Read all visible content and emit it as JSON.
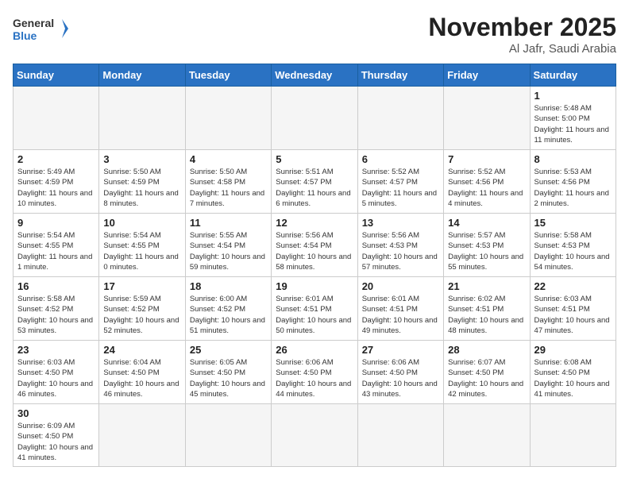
{
  "header": {
    "logo_general": "General",
    "logo_blue": "Blue",
    "title": "November 2025",
    "subtitle": "Al Jafr, Saudi Arabia"
  },
  "weekdays": [
    "Sunday",
    "Monday",
    "Tuesday",
    "Wednesday",
    "Thursday",
    "Friday",
    "Saturday"
  ],
  "weeks": [
    [
      {
        "day": null,
        "info": null
      },
      {
        "day": null,
        "info": null
      },
      {
        "day": null,
        "info": null
      },
      {
        "day": null,
        "info": null
      },
      {
        "day": null,
        "info": null
      },
      {
        "day": null,
        "info": null
      },
      {
        "day": "1",
        "info": "Sunrise: 5:48 AM\nSunset: 5:00 PM\nDaylight: 11 hours\nand 11 minutes."
      }
    ],
    [
      {
        "day": "2",
        "info": "Sunrise: 5:49 AM\nSunset: 4:59 PM\nDaylight: 11 hours\nand 10 minutes."
      },
      {
        "day": "3",
        "info": "Sunrise: 5:50 AM\nSunset: 4:59 PM\nDaylight: 11 hours\nand 8 minutes."
      },
      {
        "day": "4",
        "info": "Sunrise: 5:50 AM\nSunset: 4:58 PM\nDaylight: 11 hours\nand 7 minutes."
      },
      {
        "day": "5",
        "info": "Sunrise: 5:51 AM\nSunset: 4:57 PM\nDaylight: 11 hours\nand 6 minutes."
      },
      {
        "day": "6",
        "info": "Sunrise: 5:52 AM\nSunset: 4:57 PM\nDaylight: 11 hours\nand 5 minutes."
      },
      {
        "day": "7",
        "info": "Sunrise: 5:52 AM\nSunset: 4:56 PM\nDaylight: 11 hours\nand 4 minutes."
      },
      {
        "day": "8",
        "info": "Sunrise: 5:53 AM\nSunset: 4:56 PM\nDaylight: 11 hours\nand 2 minutes."
      }
    ],
    [
      {
        "day": "9",
        "info": "Sunrise: 5:54 AM\nSunset: 4:55 PM\nDaylight: 11 hours\nand 1 minute."
      },
      {
        "day": "10",
        "info": "Sunrise: 5:54 AM\nSunset: 4:55 PM\nDaylight: 11 hours\nand 0 minutes."
      },
      {
        "day": "11",
        "info": "Sunrise: 5:55 AM\nSunset: 4:54 PM\nDaylight: 10 hours\nand 59 minutes."
      },
      {
        "day": "12",
        "info": "Sunrise: 5:56 AM\nSunset: 4:54 PM\nDaylight: 10 hours\nand 58 minutes."
      },
      {
        "day": "13",
        "info": "Sunrise: 5:56 AM\nSunset: 4:53 PM\nDaylight: 10 hours\nand 57 minutes."
      },
      {
        "day": "14",
        "info": "Sunrise: 5:57 AM\nSunset: 4:53 PM\nDaylight: 10 hours\nand 55 minutes."
      },
      {
        "day": "15",
        "info": "Sunrise: 5:58 AM\nSunset: 4:53 PM\nDaylight: 10 hours\nand 54 minutes."
      }
    ],
    [
      {
        "day": "16",
        "info": "Sunrise: 5:58 AM\nSunset: 4:52 PM\nDaylight: 10 hours\nand 53 minutes."
      },
      {
        "day": "17",
        "info": "Sunrise: 5:59 AM\nSunset: 4:52 PM\nDaylight: 10 hours\nand 52 minutes."
      },
      {
        "day": "18",
        "info": "Sunrise: 6:00 AM\nSunset: 4:52 PM\nDaylight: 10 hours\nand 51 minutes."
      },
      {
        "day": "19",
        "info": "Sunrise: 6:01 AM\nSunset: 4:51 PM\nDaylight: 10 hours\nand 50 minutes."
      },
      {
        "day": "20",
        "info": "Sunrise: 6:01 AM\nSunset: 4:51 PM\nDaylight: 10 hours\nand 49 minutes."
      },
      {
        "day": "21",
        "info": "Sunrise: 6:02 AM\nSunset: 4:51 PM\nDaylight: 10 hours\nand 48 minutes."
      },
      {
        "day": "22",
        "info": "Sunrise: 6:03 AM\nSunset: 4:51 PM\nDaylight: 10 hours\nand 47 minutes."
      }
    ],
    [
      {
        "day": "23",
        "info": "Sunrise: 6:03 AM\nSunset: 4:50 PM\nDaylight: 10 hours\nand 46 minutes."
      },
      {
        "day": "24",
        "info": "Sunrise: 6:04 AM\nSunset: 4:50 PM\nDaylight: 10 hours\nand 46 minutes."
      },
      {
        "day": "25",
        "info": "Sunrise: 6:05 AM\nSunset: 4:50 PM\nDaylight: 10 hours\nand 45 minutes."
      },
      {
        "day": "26",
        "info": "Sunrise: 6:06 AM\nSunset: 4:50 PM\nDaylight: 10 hours\nand 44 minutes."
      },
      {
        "day": "27",
        "info": "Sunrise: 6:06 AM\nSunset: 4:50 PM\nDaylight: 10 hours\nand 43 minutes."
      },
      {
        "day": "28",
        "info": "Sunrise: 6:07 AM\nSunset: 4:50 PM\nDaylight: 10 hours\nand 42 minutes."
      },
      {
        "day": "29",
        "info": "Sunrise: 6:08 AM\nSunset: 4:50 PM\nDaylight: 10 hours\nand 41 minutes."
      }
    ],
    [
      {
        "day": "30",
        "info": "Sunrise: 6:09 AM\nSunset: 4:50 PM\nDaylight: 10 hours\nand 41 minutes."
      },
      {
        "day": null,
        "info": null
      },
      {
        "day": null,
        "info": null
      },
      {
        "day": null,
        "info": null
      },
      {
        "day": null,
        "info": null
      },
      {
        "day": null,
        "info": null
      },
      {
        "day": null,
        "info": null
      }
    ]
  ]
}
